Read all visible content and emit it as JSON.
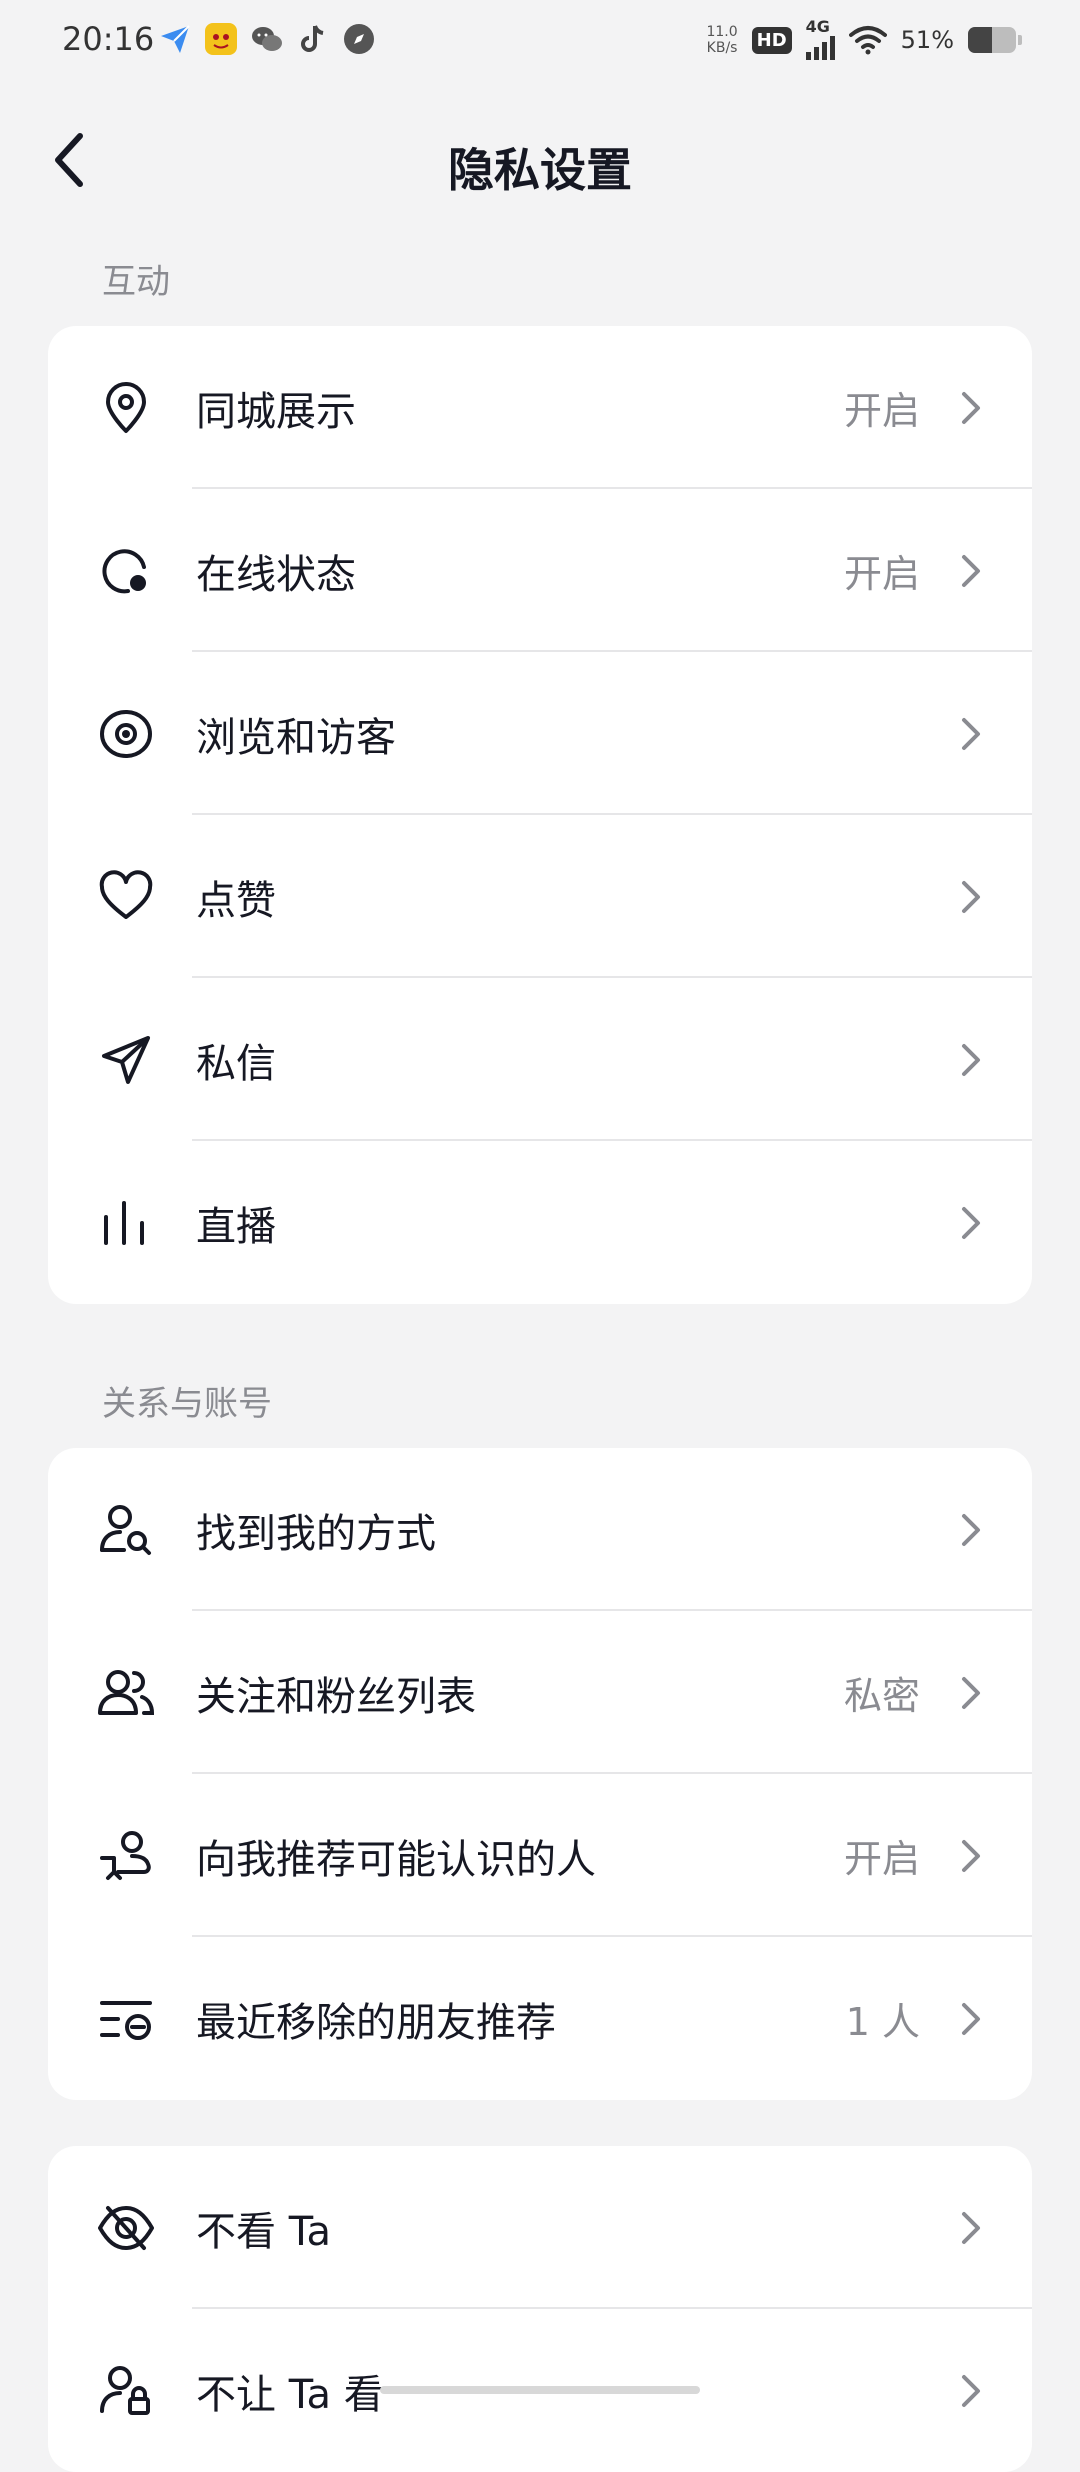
{
  "status_bar": {
    "time": "20:16",
    "net_speed_value": "11.0",
    "net_speed_unit": "KB/s",
    "hd": "HD",
    "network": "4G",
    "battery": "51%",
    "battery_level": 0.51,
    "app_icons": [
      "feishu-icon",
      "game-icon",
      "wechat-icon",
      "tiktok-icon",
      "compass-icon"
    ]
  },
  "nav": {
    "title": "隐私设置"
  },
  "sections": [
    {
      "label": "互动",
      "items": [
        {
          "label": "同城展示",
          "value": "开启",
          "icon": "location-pin-icon"
        },
        {
          "label": "在线状态",
          "value": "开启",
          "icon": "online-status-icon"
        },
        {
          "label": "浏览和访客",
          "value": "",
          "icon": "eye-icon"
        },
        {
          "label": "点赞",
          "value": "",
          "icon": "heart-icon"
        },
        {
          "label": "私信",
          "value": "",
          "icon": "paper-plane-icon"
        },
        {
          "label": "直播",
          "value": "",
          "icon": "live-bars-icon"
        }
      ]
    },
    {
      "label": "关系与账号",
      "items": [
        {
          "label": "找到我的方式",
          "value": "",
          "icon": "user-search-icon"
        },
        {
          "label": "关注和粉丝列表",
          "value": "私密",
          "icon": "users-icon"
        },
        {
          "label": "向我推荐可能认识的人",
          "value": "开启",
          "icon": "user-recommend-icon"
        },
        {
          "label": "最近移除的朋友推荐",
          "value": "1 人",
          "icon": "removed-list-icon"
        }
      ]
    },
    {
      "label": "",
      "items": [
        {
          "label": "不看 Ta",
          "value": "",
          "icon": "eye-off-icon"
        },
        {
          "label": "不让 Ta 看",
          "value": "",
          "icon": "user-lock-icon"
        }
      ]
    }
  ],
  "colors": {
    "background": "#f3f3f4",
    "card": "#ffffff",
    "text": "#161823",
    "secondary": "#8a8b91",
    "divider": "#e6e6e8"
  }
}
